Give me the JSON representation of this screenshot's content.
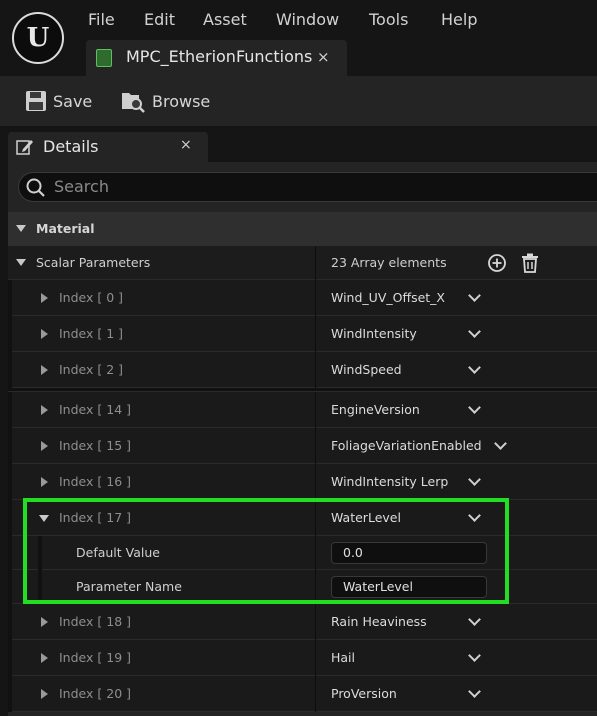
{
  "menu": {
    "items": [
      "File",
      "Edit",
      "Asset",
      "Window",
      "Tools",
      "Help"
    ]
  },
  "asset_tab": {
    "label": "MPC_EtherionFunctions",
    "close": "×"
  },
  "toolbar": {
    "save_label": "Save",
    "browse_label": "Browse"
  },
  "details": {
    "tab_label": "Details",
    "close": "×",
    "search_placeholder": "Search",
    "category": "Material",
    "scalar": {
      "label": "Scalar Parameters",
      "count": "23 Array elements"
    },
    "rows": [
      {
        "index": "Index [ 0 ]",
        "value": "Wind_UV_Offset_X"
      },
      {
        "index": "Index [ 1 ]",
        "value": "WindIntensity"
      },
      {
        "index": "Index [ 2 ]",
        "value": "WindSpeed"
      },
      {
        "index": "Index [ 14 ]",
        "value": "EngineVersion"
      },
      {
        "index": "Index [ 15 ]",
        "value": "FoliageVariationEnabled"
      },
      {
        "index": "Index [ 16 ]",
        "value": "WindIntensity Lerp"
      },
      {
        "index": "Index [ 17 ]",
        "value": "WaterLevel"
      },
      {
        "index": "Index [ 18 ]",
        "value": "Rain Heaviness"
      },
      {
        "index": "Index [ 19 ]",
        "value": "Hail"
      },
      {
        "index": "Index [ 20 ]",
        "value": "ProVersion"
      }
    ],
    "expanded": {
      "default_value_label": "Default Value",
      "default_value": "0.0",
      "parameter_name_label": "Parameter Name",
      "parameter_name": "WaterLevel"
    }
  },
  "colors": {
    "highlight": "#22dd22",
    "panel": "#242424",
    "background": "#151515"
  }
}
